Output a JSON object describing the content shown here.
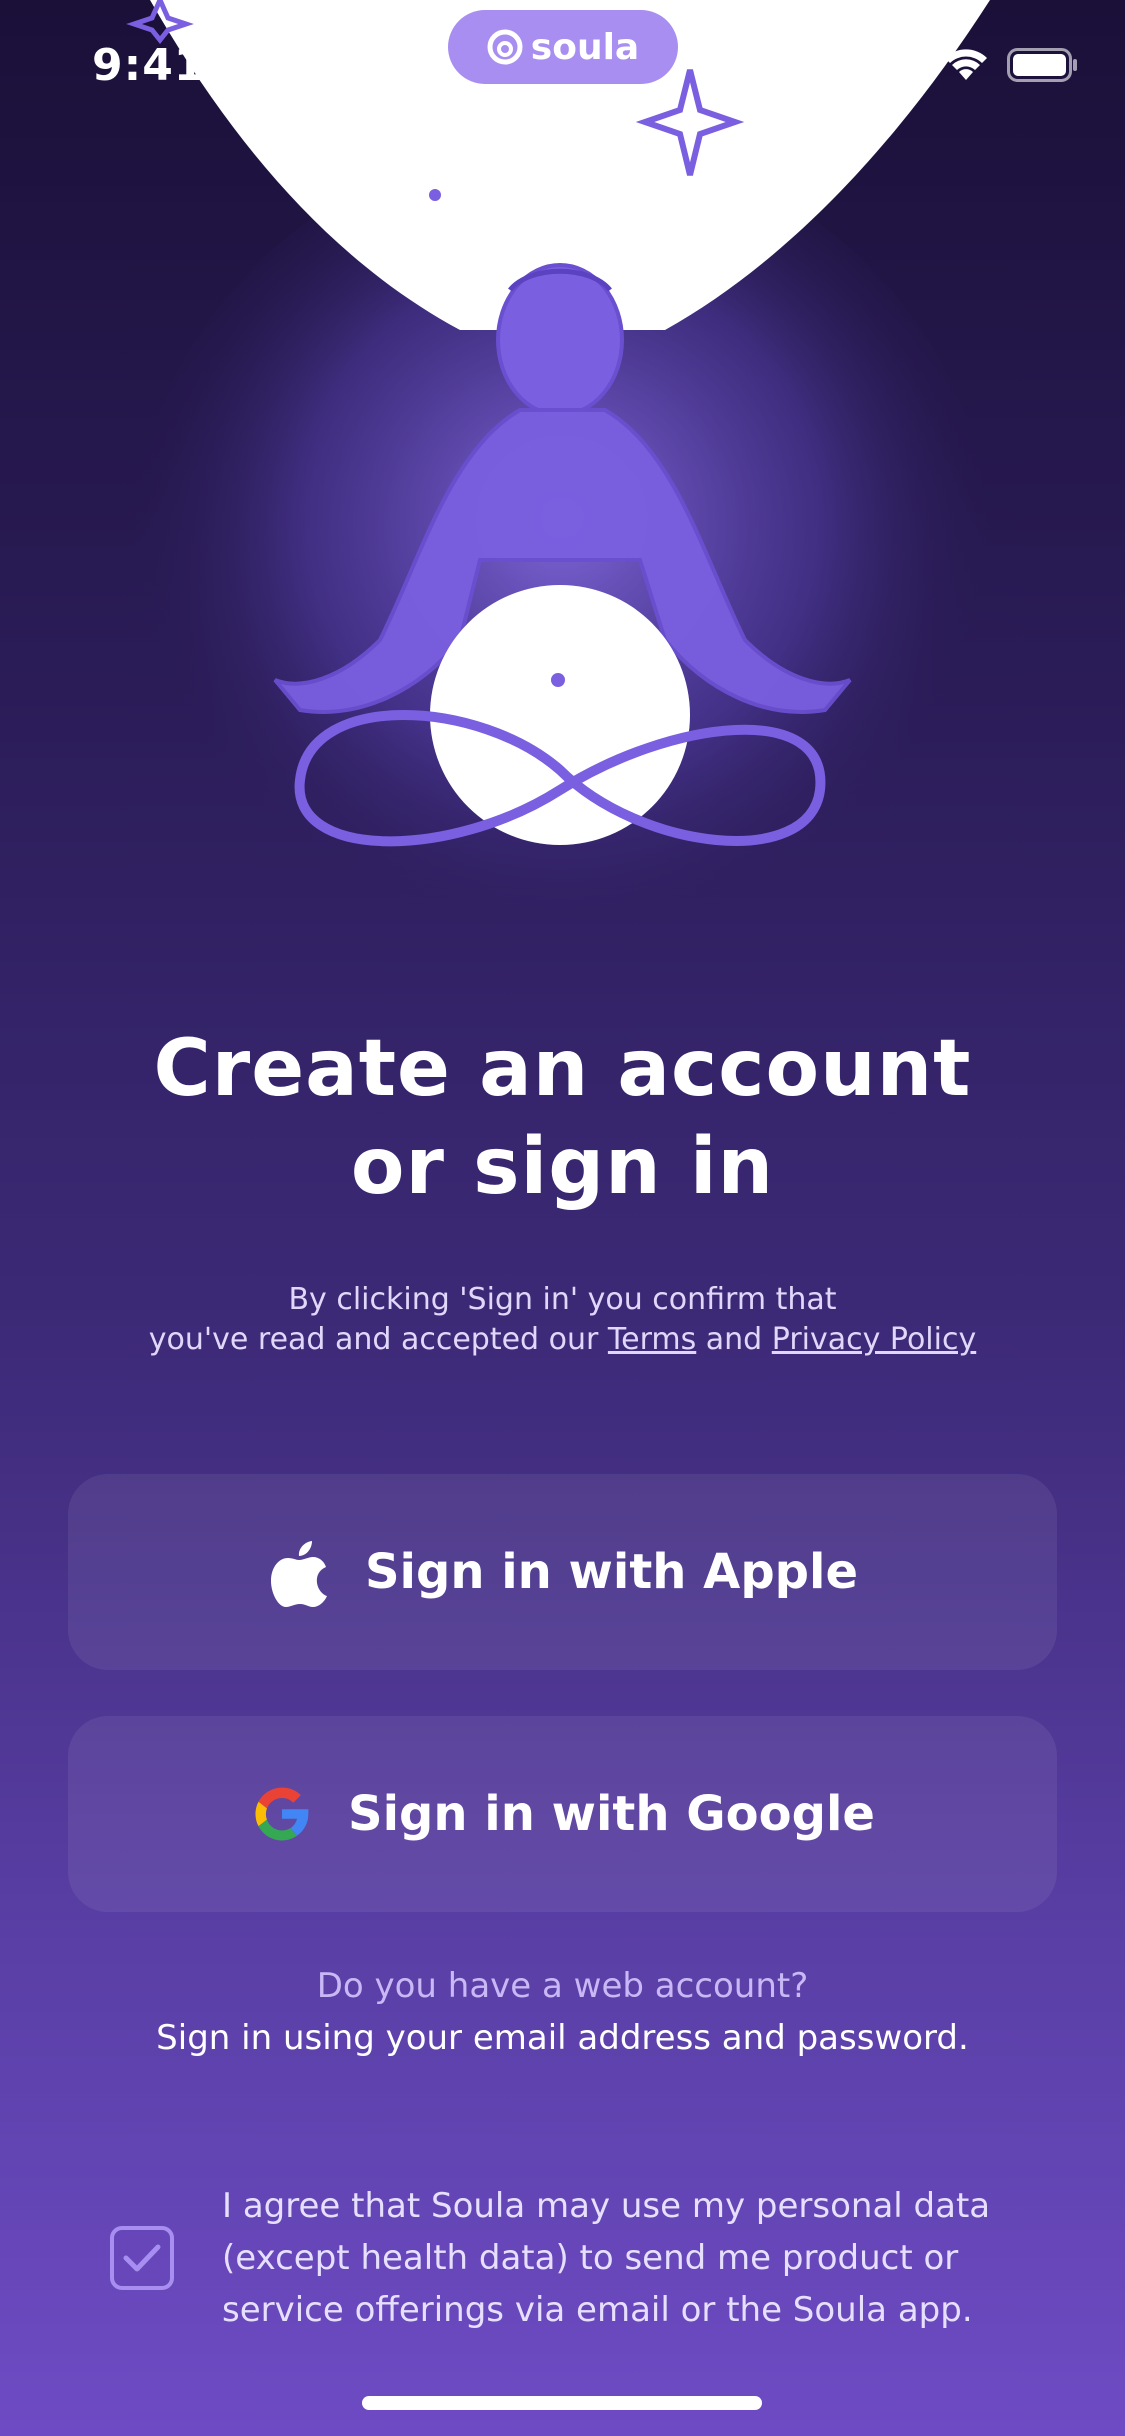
{
  "status_bar": {
    "time": "9:41"
  },
  "brand": {
    "name": "soula"
  },
  "headline": {
    "line1": "Create an account",
    "line2": "or sign in"
  },
  "consent": {
    "prefix": "By clicking 'Sign in' you confirm that",
    "line2_prefix": "you've read and accepted our ",
    "terms": "Terms",
    "and": " and ",
    "privacy": "Privacy Policy"
  },
  "buttons": {
    "apple": "Sign in with Apple",
    "google": "Sign in with Google"
  },
  "web_account": {
    "question": "Do you have a web account?",
    "action": "Sign in using your email address and password."
  },
  "agreement": {
    "checked": true,
    "text": "I agree that Soula may use my personal data (except health data) to send me product or service offerings via email or the Soula app."
  },
  "colors": {
    "accent": "#a88ef0",
    "background_top": "#1a1038",
    "background_bottom": "#6e4bc4"
  },
  "icons": [
    "apple-icon",
    "google-icon",
    "checkbox-check-icon",
    "signal-icon",
    "wifi-icon",
    "battery-icon",
    "soula-logo-icon"
  ]
}
